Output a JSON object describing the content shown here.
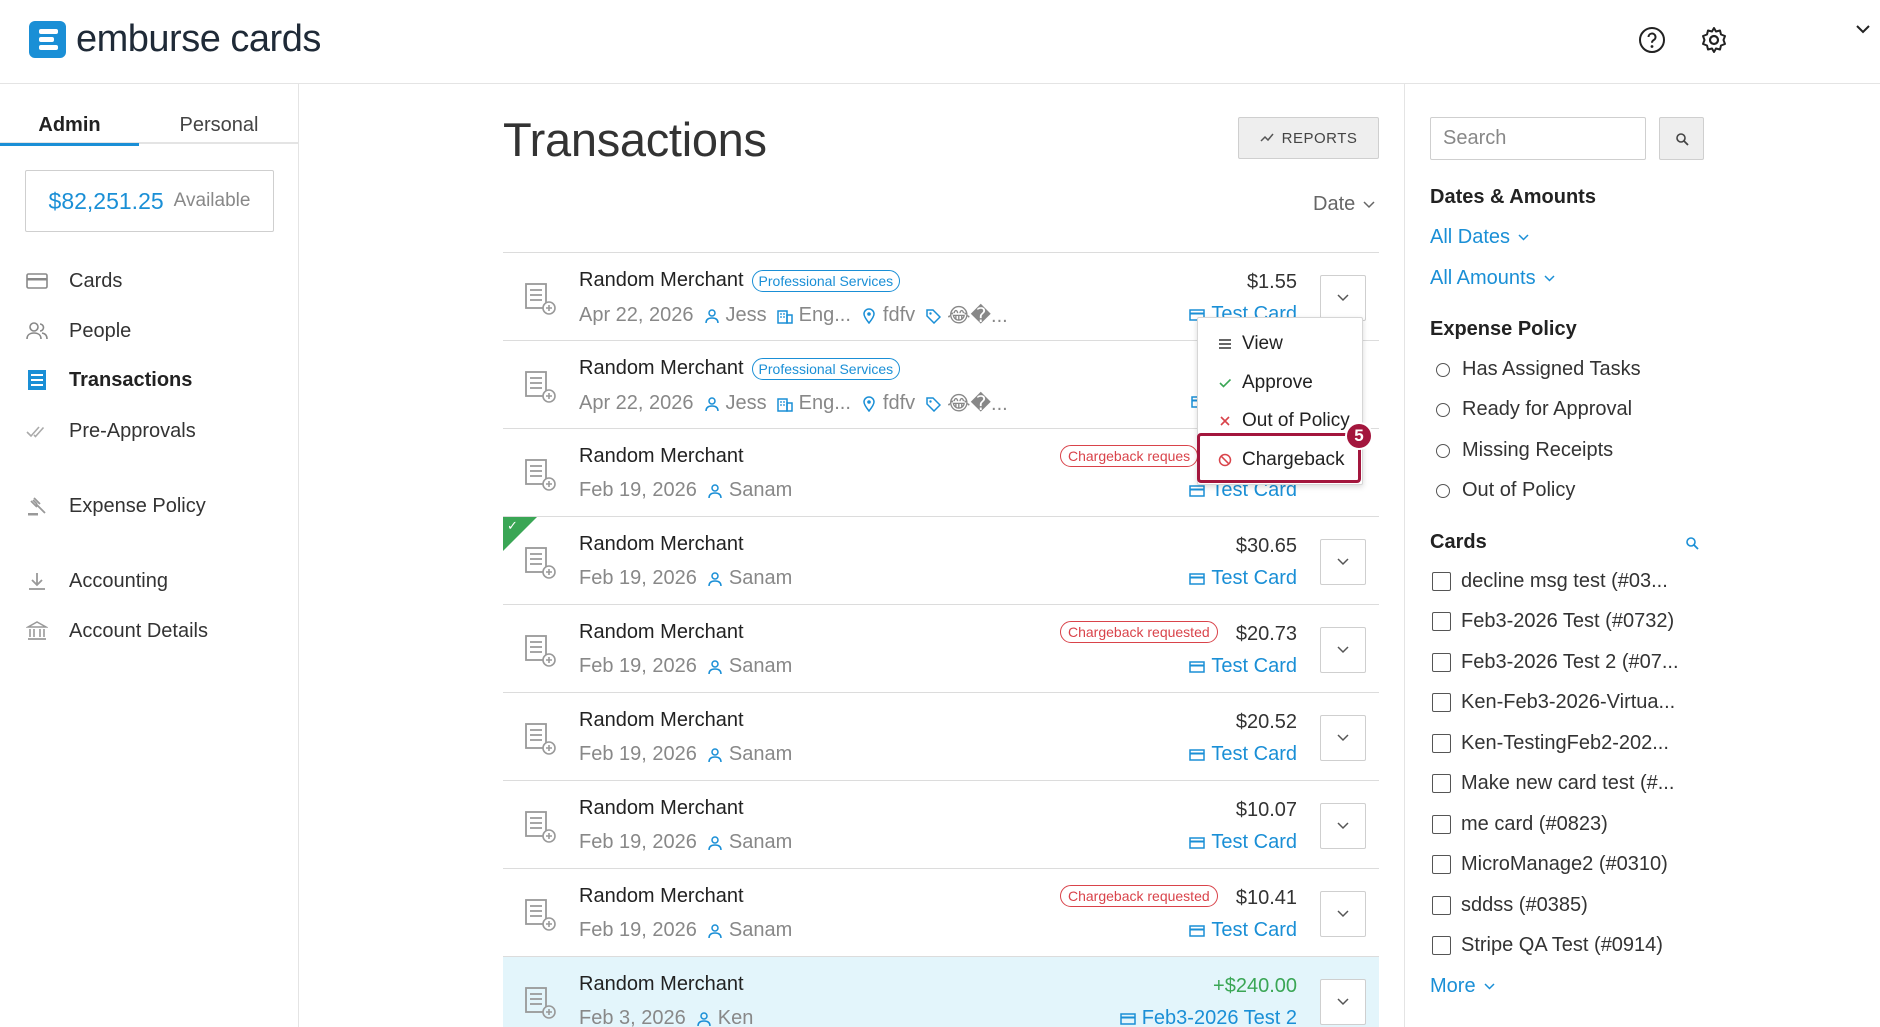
{
  "app": {
    "logo_text": "emburse cards"
  },
  "sidebar": {
    "tabs": [
      {
        "label": "Admin"
      },
      {
        "label": "Personal"
      }
    ],
    "balance": {
      "amount": "$82,251.25",
      "label": "Available"
    },
    "items": [
      {
        "label": "Cards",
        "icon": "credit-card-icon"
      },
      {
        "label": "People",
        "icon": "people-icon"
      },
      {
        "label": "Transactions",
        "icon": "transactions-icon"
      },
      {
        "label": "Pre-Approvals",
        "icon": "double-check-icon"
      },
      {
        "label": "Expense Policy",
        "icon": "gavel-icon"
      },
      {
        "label": "Accounting",
        "icon": "download-icon"
      },
      {
        "label": "Account Details",
        "icon": "bank-icon"
      }
    ]
  },
  "main": {
    "title": "Transactions",
    "reports_label": "REPORTS",
    "sort_label": "Date",
    "transactions": [
      {
        "merchant": "Random Merchant",
        "category": "Professional Services",
        "date": "Apr 22, 2026",
        "user": "Jess",
        "dept": "Eng...",
        "location": "fdfv",
        "tags": "😂�...",
        "amount": "$1.55",
        "card": "Test Card",
        "chargeback": ""
      },
      {
        "merchant": "Random Merchant",
        "category": "Professional Services",
        "date": "Apr 22, 2026",
        "user": "Jess",
        "dept": "Eng...",
        "location": "fdfv",
        "tags": "😂�...",
        "amount": "",
        "card": "",
        "chargeback": ""
      },
      {
        "merchant": "Random Merchant",
        "category": "",
        "date": "Feb 19, 2026",
        "user": "Sanam",
        "amount": "",
        "card": "Test Card",
        "chargeback": "Chargeback reques"
      },
      {
        "merchant": "Random Merchant",
        "category": "",
        "date": "Feb 19, 2026",
        "user": "Sanam",
        "amount": "$30.65",
        "card": "Test Card",
        "chargeback": "",
        "approved": true
      },
      {
        "merchant": "Random Merchant",
        "category": "",
        "date": "Feb 19, 2026",
        "user": "Sanam",
        "amount": "$20.73",
        "card": "Test Card",
        "chargeback": "Chargeback requested"
      },
      {
        "merchant": "Random Merchant",
        "category": "",
        "date": "Feb 19, 2026",
        "user": "Sanam",
        "amount": "$20.52",
        "card": "Test Card",
        "chargeback": ""
      },
      {
        "merchant": "Random Merchant",
        "category": "",
        "date": "Feb 19, 2026",
        "user": "Sanam",
        "amount": "$10.07",
        "card": "Test Card",
        "chargeback": ""
      },
      {
        "merchant": "Random Merchant",
        "category": "",
        "date": "Feb 19, 2026",
        "user": "Sanam",
        "amount": "$10.41",
        "card": "Test Card",
        "chargeback": "Chargeback requested"
      },
      {
        "merchant": "Random Merchant",
        "category": "",
        "date": "Feb 3, 2026",
        "user": "Ken",
        "amount": "+$240.00",
        "card": "Feb3-2026 Test 2",
        "chargeback": "",
        "highlighted": true
      }
    ],
    "menu": {
      "items": [
        {
          "label": "View",
          "icon": "list-icon"
        },
        {
          "label": "Approve",
          "icon": "check-icon"
        },
        {
          "label": "Out of Policy",
          "icon": "x-icon"
        },
        {
          "label": "Chargeback",
          "icon": "block-icon"
        }
      ],
      "step": "5"
    }
  },
  "filters": {
    "search_placeholder": "Search",
    "dates_amounts": {
      "title": "Dates & Amounts",
      "dates": "All Dates",
      "amounts": "All Amounts"
    },
    "expense_policy": {
      "title": "Expense Policy",
      "options": [
        "Has Assigned Tasks",
        "Ready for Approval",
        "Missing Receipts",
        "Out of Policy"
      ]
    },
    "cards": {
      "title": "Cards",
      "options": [
        "decline msg test (#03...",
        "Feb3-2026 Test (#0732)",
        "Feb3-2026 Test 2 (#07...",
        "Ken-Feb3-2026-Virtua...",
        "Ken-TestingFeb2-202...",
        "Make new card test (#...",
        "me card (#0823)",
        "MicroManage2 (#0310)",
        "sddss (#0385)",
        "Stripe QA Test (#0914)"
      ],
      "more": "More"
    }
  },
  "colors": {
    "accent": "#1a8fd6",
    "danger": "#d9434a",
    "success": "#3aa655",
    "highlight": "#a3163d"
  }
}
